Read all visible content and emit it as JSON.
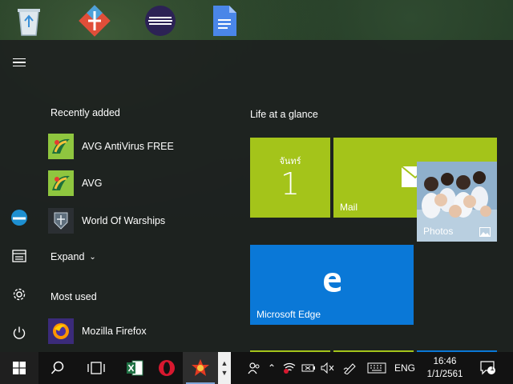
{
  "start_menu": {
    "recently_added_heading": "Recently added",
    "recent_apps": [
      {
        "name": "AVG AntiVirus FREE",
        "icon": "avg-icon"
      },
      {
        "name": "AVG",
        "icon": "avg-icon"
      },
      {
        "name": "World Of Warships",
        "icon": "world-of-warships-icon"
      }
    ],
    "expand_label": "Expand",
    "most_used_heading": "Most used",
    "most_used_apps": [
      {
        "name": "Mozilla Firefox",
        "icon": "firefox-icon"
      }
    ],
    "tiles_heading": "Life at a glance",
    "tiles": {
      "calendar_day": "จันทร์",
      "calendar_date": "1",
      "mail_label": "Mail",
      "photos_label": "Photos",
      "edge_label": "Microsoft Edge"
    },
    "rail_icons": [
      "hamburger-icon",
      "xearn-icon",
      "documents-icon",
      "settings-icon",
      "power-icon"
    ]
  },
  "desktop": {
    "icons": [
      "recycle-bin-icon",
      "gitkraken-icon",
      "eclipse-icon",
      "google-docs-icon"
    ]
  },
  "taskbar": {
    "tray_language": "ENG",
    "clock_time": "16:46",
    "clock_date": "1/1/2561",
    "notification_count": "1"
  },
  "colors": {
    "tile_green": "#a4c41a",
    "tile_blue": "#0a78d7",
    "start_bg": "#1e2220",
    "taskbar_bg": "#121212"
  }
}
